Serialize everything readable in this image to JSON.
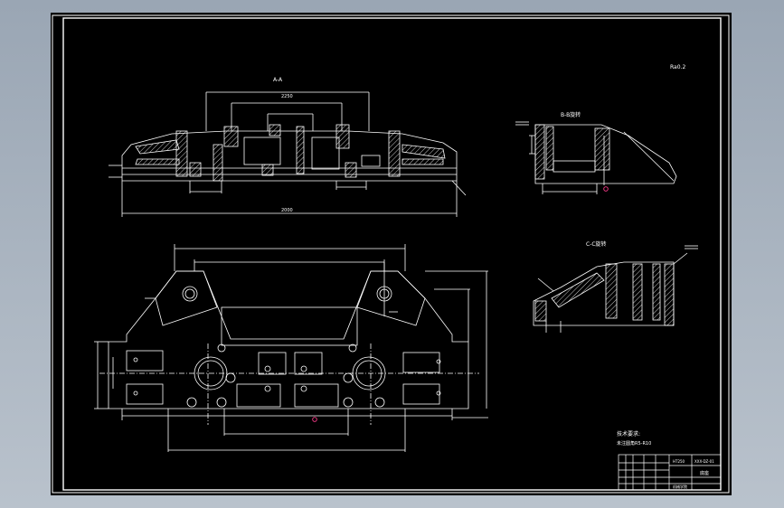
{
  "drawing": {
    "section_a_label": "A-A",
    "section_b_label": "B-B旋转",
    "section_c_label": "C-C旋转",
    "roughness_note": "Ra0.2",
    "top_dim": "2250",
    "overall_width_dim": "2000",
    "tech_req_title": "技术要求:",
    "tech_req_line1": "未注圆角R5-R10",
    "tb_material": "HT250",
    "tb_part_name": "底座",
    "tb_school": "机械学院",
    "tb_drawing_no": "XXX-DZ-01"
  },
  "colors": {
    "background_gradient_top": "#9aa6b4",
    "sheet": "#000000",
    "line": "#ffffff",
    "hatch": "#ffffff",
    "marker": "#ff3c8c"
  }
}
